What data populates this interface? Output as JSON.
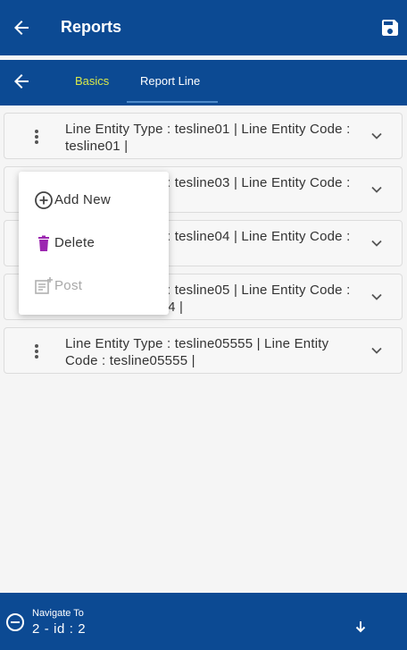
{
  "header": {
    "title": "Reports"
  },
  "tabs": [
    {
      "label": "Basics"
    },
    {
      "label": "Report Line"
    }
  ],
  "lines": [
    {
      "text": "Line Entity Type : tesline01 | Line Entity Code : tesline01 |"
    },
    {
      "text": "Line Entity Type : tesline03 | Line Entity Code : tesline03 |"
    },
    {
      "text": "Line Entity Type : tesline04 | Line Entity Code : tesline04 |"
    },
    {
      "text": "Line Entity Type : tesline05 | Line Entity Code : tesline04tesline04 |"
    },
    {
      "text": "Line Entity Type : tesline05555 | Line Entity Code : tesline05555 |"
    }
  ],
  "context_menu": {
    "items": [
      {
        "label": "Add New",
        "icon": "plus-circle-icon"
      },
      {
        "label": "Delete",
        "icon": "trash-icon"
      },
      {
        "label": "Post",
        "icon": "post-icon",
        "disabled": true
      }
    ]
  },
  "footer": {
    "nav_label": "Navigate To",
    "nav_value": "2 - id : 2"
  },
  "colors": {
    "primary": "#0c4a93",
    "active_tab": "#d8e84a",
    "delete_icon": "#9c27b0"
  }
}
